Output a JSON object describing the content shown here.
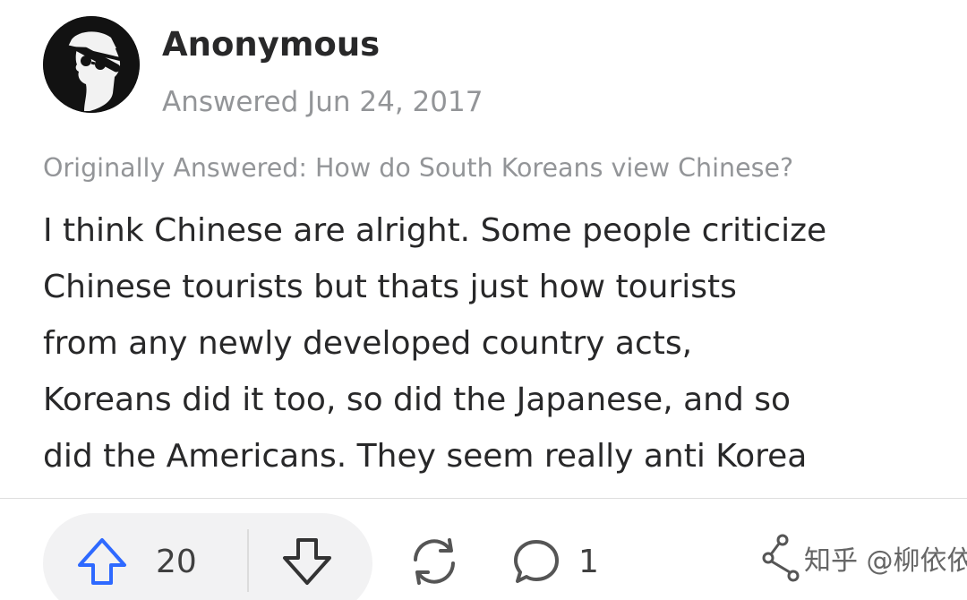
{
  "author": {
    "name": "Anonymous",
    "answered": "Answered Jun 24, 2017"
  },
  "original_question": "Originally Answered: How do South Koreans view Chinese?",
  "answer_lines": [
    "I think Chinese are alright. Some people criticize",
    "Chinese tourists but thats just how tourists",
    "from any newly developed country acts,",
    "Koreans did it too, so did the Japanese, and so",
    "did the Americans. They seem really anti Korea"
  ],
  "actions": {
    "upvotes": "20",
    "comments": "1"
  },
  "watermark": "知乎 @柳依依",
  "colors": {
    "upvote_accent": "#2e69ff",
    "text": "#282829",
    "muted": "#939598"
  }
}
